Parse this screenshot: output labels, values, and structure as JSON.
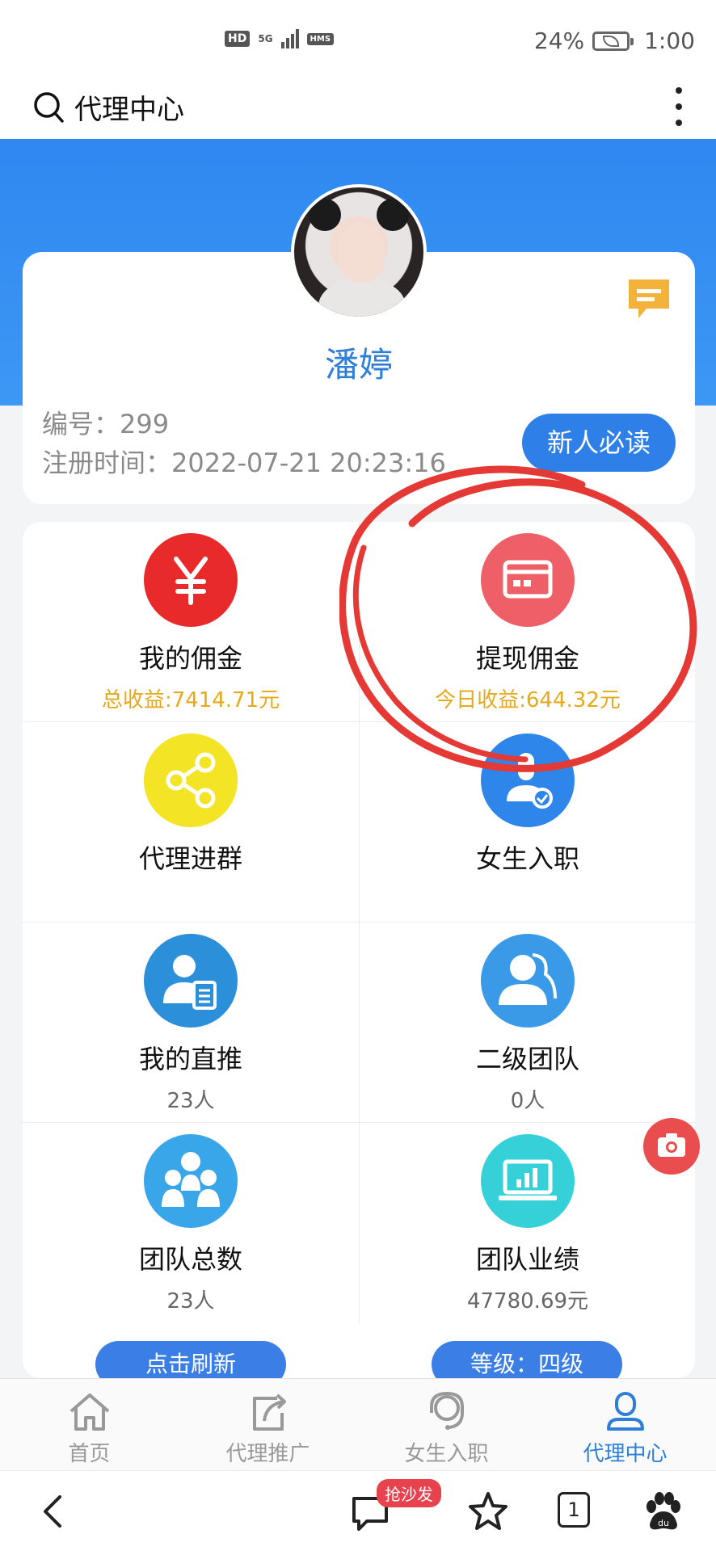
{
  "status_bar": {
    "hd_label": "HD",
    "network_label": "5G",
    "hms_label": "HMS",
    "battery_percent": "24%",
    "time": "1:00"
  },
  "header": {
    "title": "代理中心",
    "search_icon": "search-icon",
    "more_icon": "more-vertical-icon"
  },
  "profile": {
    "name": "潘婷",
    "id_text": "编号：299",
    "register_text": "注册时间：2022-07-21 20:23:16",
    "newbie_button": "新人必读",
    "message_icon": "message-icon"
  },
  "grid": [
    {
      "label": "我的佣金",
      "sub": "总收益:7414.71元",
      "icon": "yuan-icon",
      "color": "#e82a2a"
    },
    {
      "label": "提现佣金",
      "sub": "今日收益:644.32元",
      "icon": "card-icon",
      "color": "#ef5f68"
    },
    {
      "label": "代理进群",
      "sub": "",
      "icon": "share-icon",
      "color": "#f3e426"
    },
    {
      "label": "女生入职",
      "sub": "",
      "icon": "user-check-icon",
      "color": "#2f86ea"
    },
    {
      "label": "我的直推",
      "sub": "23人",
      "icon": "user-doc-icon",
      "color": "#2c8fd9"
    },
    {
      "label": "二级团队",
      "sub": "0人",
      "icon": "users-icon",
      "color": "#3a9ae8"
    },
    {
      "label": "团队总数",
      "sub": "23人",
      "icon": "group-icon",
      "color": "#39a6ea"
    },
    {
      "label": "团队业绩",
      "sub": "47780.69元",
      "icon": "laptop-chart-icon",
      "color": "#35d0d8"
    }
  ],
  "grid_buttons": {
    "refresh": "点击刷新",
    "level": "等级：四级"
  },
  "bottom_nav": [
    {
      "label": "首页",
      "icon": "home-icon"
    },
    {
      "label": "代理推广",
      "icon": "share-arrow-icon"
    },
    {
      "label": "女生入职",
      "icon": "headset-icon"
    },
    {
      "label": "代理中心",
      "icon": "user-icon",
      "active": true
    }
  ],
  "browser_bar": {
    "sofa_badge": "抢沙发",
    "tab_count": "1"
  },
  "colors": {
    "primary_blue": "#2f7fe8",
    "gold": "#e6a91a",
    "annotation_red": "#e53935"
  }
}
